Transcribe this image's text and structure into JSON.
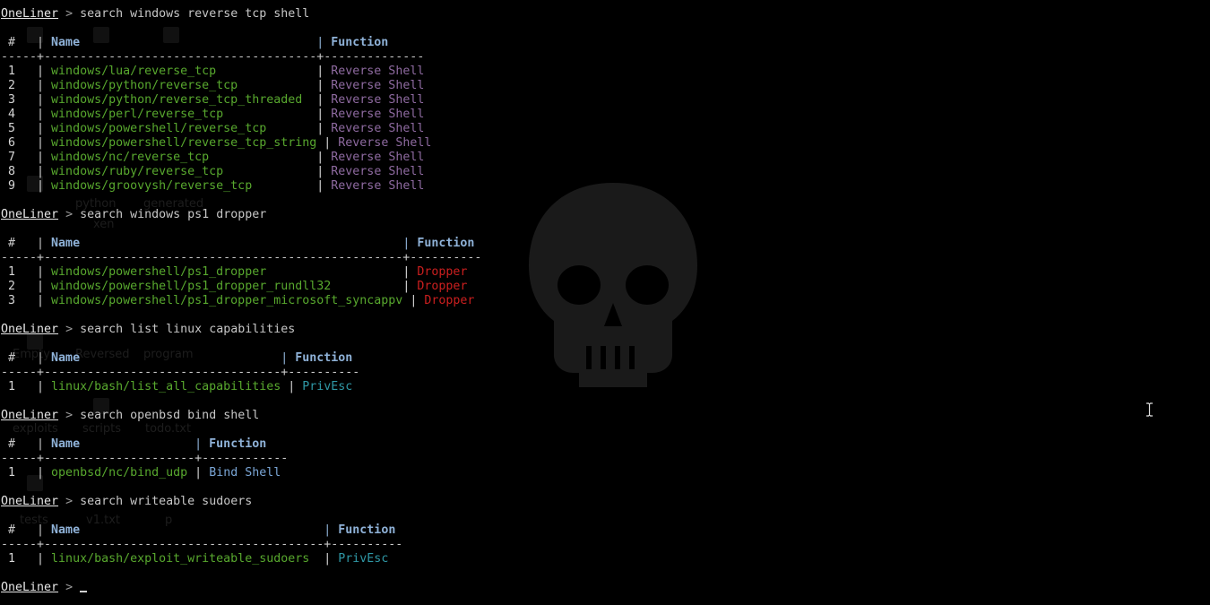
{
  "prompt": {
    "name": "OneLiner",
    "arrow": ">"
  },
  "headers": {
    "num": "#",
    "name": "Name",
    "function": "Function"
  },
  "blocks": [
    {
      "command": "search windows reverse tcp shell",
      "name_width": 38,
      "func_width": 14,
      "rows": [
        {
          "idx": "1",
          "path": "windows/lua/reverse_tcp",
          "func": "Reverse Shell",
          "type": "rev"
        },
        {
          "idx": "2",
          "path": "windows/python/reverse_tcp",
          "func": "Reverse Shell",
          "type": "rev"
        },
        {
          "idx": "3",
          "path": "windows/python/reverse_tcp_threaded",
          "func": "Reverse Shell",
          "type": "rev"
        },
        {
          "idx": "4",
          "path": "windows/perl/reverse_tcp",
          "func": "Reverse Shell",
          "type": "rev"
        },
        {
          "idx": "5",
          "path": "windows/powershell/reverse_tcp",
          "func": "Reverse Shell",
          "type": "rev"
        },
        {
          "idx": "6",
          "path": "windows/powershell/reverse_tcp_string",
          "func": "Reverse Shell",
          "type": "rev"
        },
        {
          "idx": "7",
          "path": "windows/nc/reverse_tcp",
          "func": "Reverse Shell",
          "type": "rev"
        },
        {
          "idx": "8",
          "path": "windows/ruby/reverse_tcp",
          "func": "Reverse Shell",
          "type": "rev"
        },
        {
          "idx": "9",
          "path": "windows/groovysh/reverse_tcp",
          "func": "Reverse Shell",
          "type": "rev"
        }
      ]
    },
    {
      "command": "search windows ps1 dropper",
      "name_width": 50,
      "func_width": 10,
      "rows": [
        {
          "idx": "1",
          "path": "windows/powershell/ps1_dropper",
          "func": "Dropper",
          "type": "drop"
        },
        {
          "idx": "2",
          "path": "windows/powershell/ps1_dropper_rundll32",
          "func": "Dropper",
          "type": "drop"
        },
        {
          "idx": "3",
          "path": "windows/powershell/ps1_dropper_microsoft_syncappv",
          "func": "Dropper",
          "type": "drop"
        }
      ]
    },
    {
      "command": "search list linux capabilities",
      "name_width": 33,
      "func_width": 10,
      "rows": [
        {
          "idx": "1",
          "path": "linux/bash/list_all_capabilities",
          "func": "PrivEsc",
          "type": "priv"
        }
      ]
    },
    {
      "command": "search openbsd bind shell",
      "name_width": 21,
      "func_width": 12,
      "rows": [
        {
          "idx": "1",
          "path": "openbsd/nc/bind_udp",
          "func": "Bind Shell",
          "type": "bind"
        }
      ]
    },
    {
      "command": "search writeable sudoers",
      "name_width": 39,
      "func_width": 10,
      "rows": [
        {
          "idx": "1",
          "path": "linux/bash/exploit_writeable_sudoers",
          "func": "PrivEsc",
          "type": "priv"
        }
      ]
    }
  ],
  "final_prompt": {
    "command": ""
  },
  "wallpaper": {
    "labels": [
      "Empty",
      "Reversed",
      "program",
      "exploits",
      "scripts",
      "todo.txt",
      "tests",
      "v1.txt",
      "p",
      "python",
      "generated",
      "xen"
    ]
  },
  "colors": {
    "background": "#000000",
    "path": "#58a82e",
    "reverse_shell": "#8e6aa0",
    "dropper": "#cc1f1f",
    "privesc": "#2f98a6",
    "bind_shell": "#7aa6d6",
    "header": "#8fb2d8"
  }
}
